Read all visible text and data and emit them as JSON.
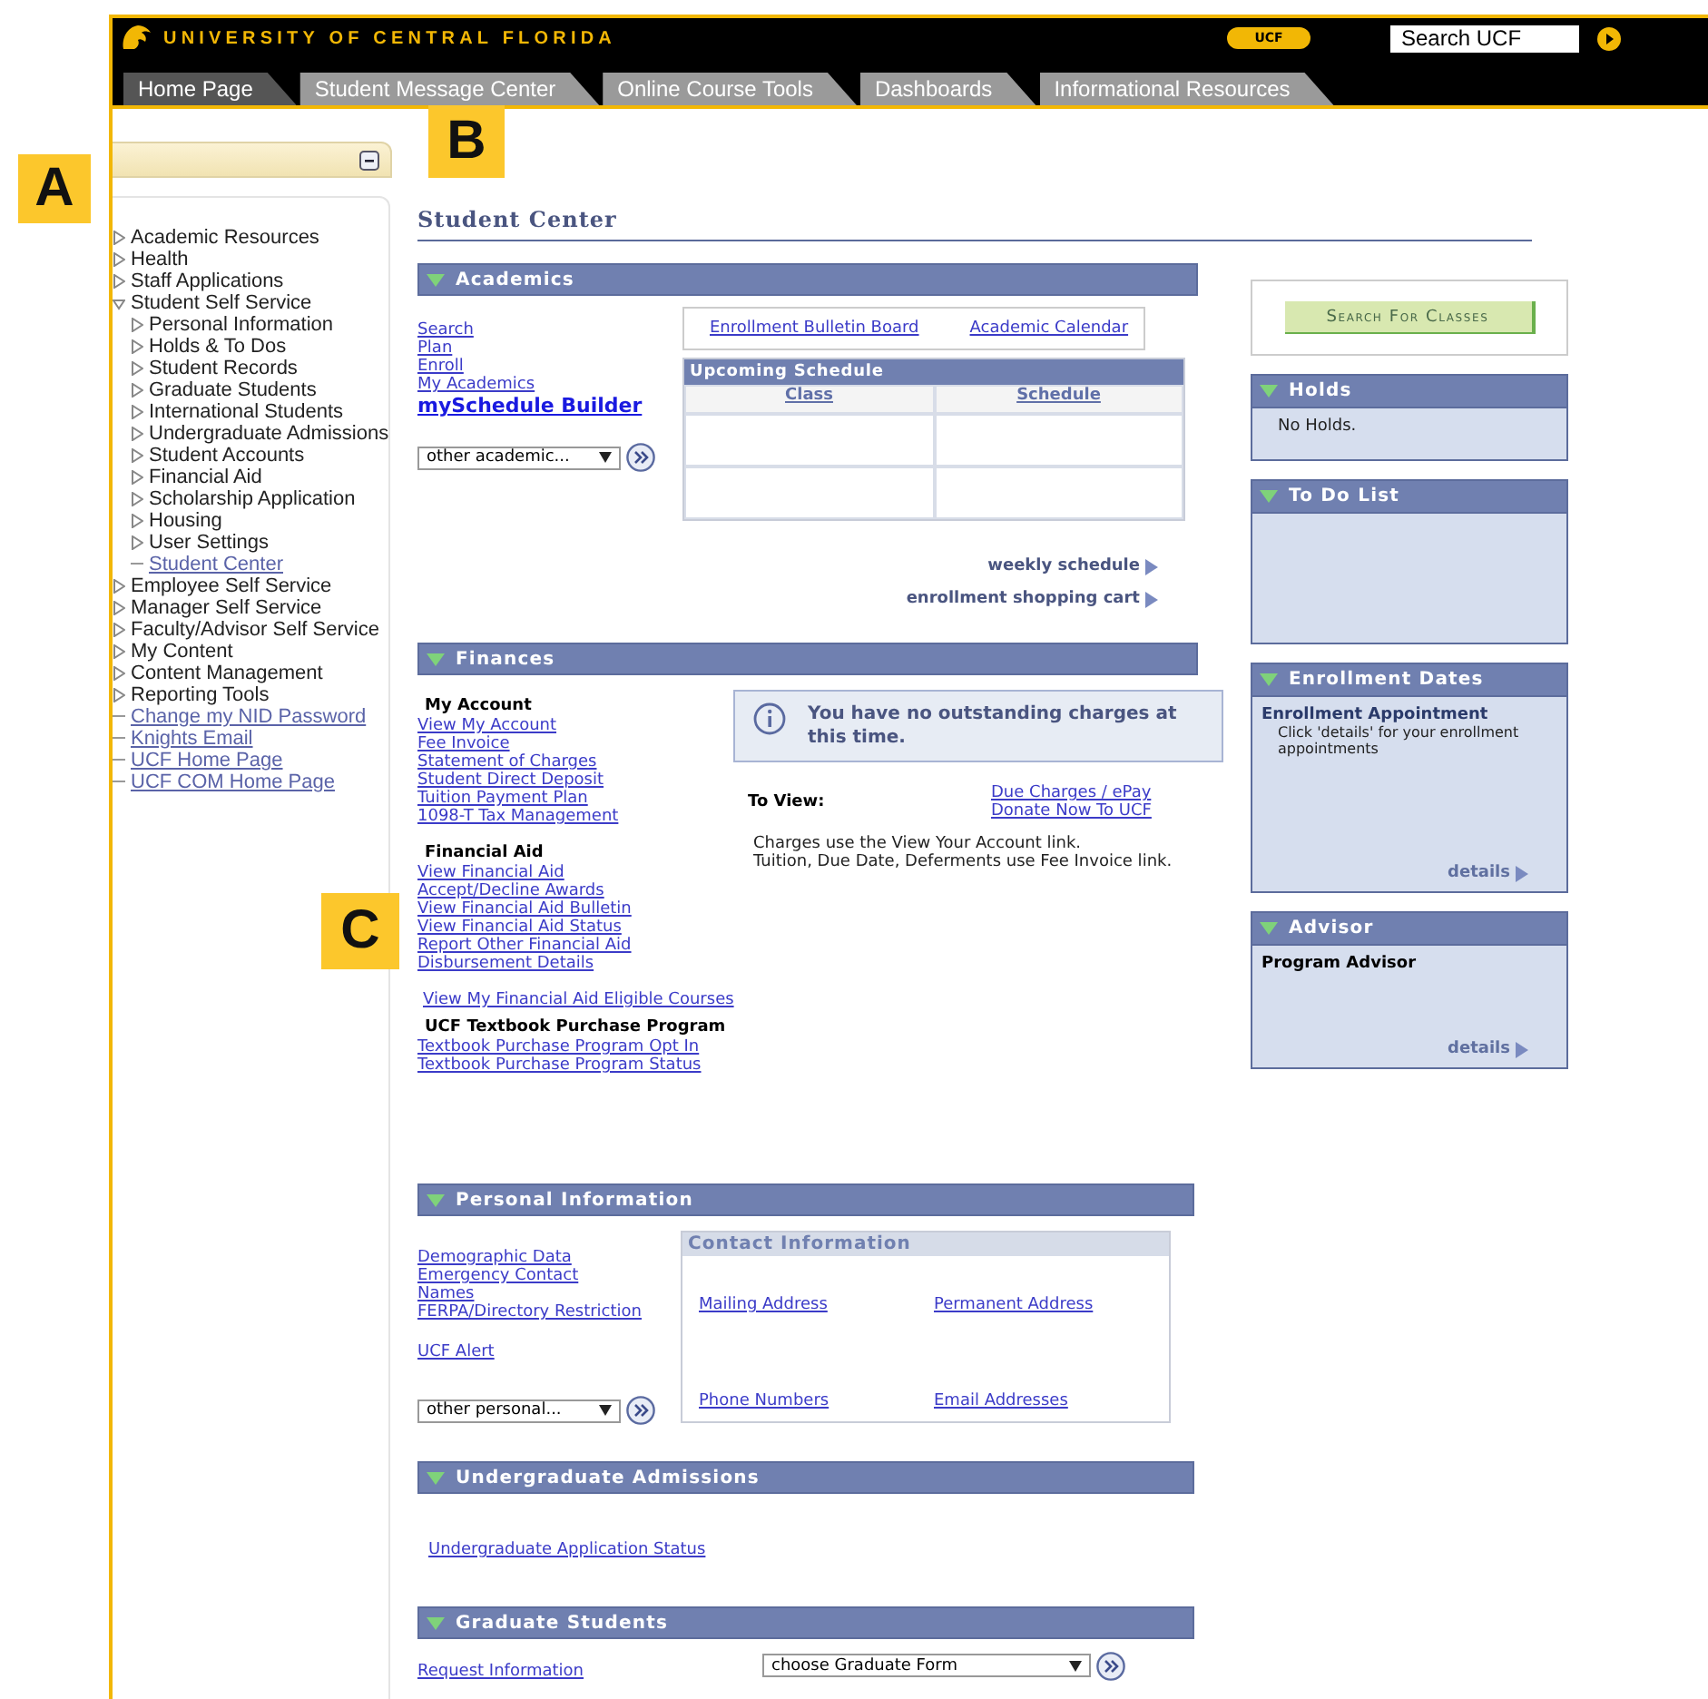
{
  "callouts": [
    "A",
    "B",
    "C"
  ],
  "header": {
    "university": "UNIVERSITY OF CENTRAL FLORIDA",
    "badge": "UCF",
    "search": {
      "placeholder": "Search UCF"
    }
  },
  "tabs": [
    {
      "label": "Home Page",
      "selected": true
    },
    {
      "label": "Student Message Center",
      "selected": false
    },
    {
      "label": "Online Course Tools",
      "selected": false
    },
    {
      "label": "Dashboards",
      "selected": false
    },
    {
      "label": "Informational Resources",
      "selected": false
    }
  ],
  "sidebar": {
    "items": [
      {
        "label": "Academic Resources",
        "kind": "folder",
        "expanded": false
      },
      {
        "label": "Health",
        "kind": "folder",
        "expanded": false
      },
      {
        "label": "Staff Applications",
        "kind": "folder",
        "expanded": false
      },
      {
        "label": "Student Self Service",
        "kind": "folder",
        "expanded": true,
        "children": [
          {
            "label": "Personal Information",
            "kind": "folder",
            "expanded": false
          },
          {
            "label": "Holds & To Dos",
            "kind": "folder",
            "expanded": false
          },
          {
            "label": "Student Records",
            "kind": "folder",
            "expanded": false
          },
          {
            "label": "Graduate Students",
            "kind": "folder",
            "expanded": false
          },
          {
            "label": "International Students",
            "kind": "folder",
            "expanded": false
          },
          {
            "label": "Undergraduate Admissions",
            "kind": "folder",
            "expanded": false
          },
          {
            "label": "Student Accounts",
            "kind": "folder",
            "expanded": false
          },
          {
            "label": "Financial Aid",
            "kind": "folder",
            "expanded": false
          },
          {
            "label": "Scholarship Application",
            "kind": "folder",
            "expanded": false
          },
          {
            "label": "Housing",
            "kind": "folder",
            "expanded": false
          },
          {
            "label": "User Settings",
            "kind": "folder",
            "expanded": false
          },
          {
            "label": "Student Center",
            "kind": "link"
          }
        ]
      },
      {
        "label": "Employee Self Service",
        "kind": "folder",
        "expanded": false
      },
      {
        "label": "Manager Self Service",
        "kind": "folder",
        "expanded": false
      },
      {
        "label": "Faculty/Advisor Self Service",
        "kind": "folder",
        "expanded": false
      },
      {
        "label": "My Content",
        "kind": "folder",
        "expanded": false
      },
      {
        "label": "Content Management",
        "kind": "folder",
        "expanded": false
      },
      {
        "label": "Reporting Tools",
        "kind": "folder",
        "expanded": false
      },
      {
        "label": "Change my NID Password",
        "kind": "link"
      },
      {
        "label": "Knights Email",
        "kind": "link"
      },
      {
        "label": "UCF Home Page",
        "kind": "link"
      },
      {
        "label": "UCF COM Home Page",
        "kind": "link"
      }
    ]
  },
  "main": {
    "title": "Student Center",
    "academics": {
      "title": "Academics",
      "links": [
        "Search",
        "Plan",
        "Enroll",
        "My Academics"
      ],
      "builder": "mySchedule Builder",
      "dropdown": "other academic...",
      "top_links": [
        "Enrollment Bulletin Board",
        "Academic Calendar"
      ],
      "schedule": {
        "title": "Upcoming Schedule",
        "columns": [
          "Class",
          "Schedule"
        ]
      },
      "bottom_links": [
        "weekly schedule",
        "enrollment shopping cart"
      ]
    },
    "finances": {
      "title": "Finances",
      "groups": [
        {
          "heading": "My Account",
          "links": [
            "View My Account",
            "Fee Invoice",
            "Statement of Charges",
            "Student Direct Deposit",
            "Tuition Payment Plan",
            "1098-T Tax Management"
          ]
        },
        {
          "heading": "Financial Aid",
          "links": [
            "View Financial Aid",
            "Accept/Decline Awards",
            "View Financial Aid Bulletin",
            "View Financial Aid Status",
            "Report Other Financial Aid",
            "Disbursement Details"
          ]
        },
        {
          "links": [
            "View My Financial Aid Eligible Courses"
          ]
        },
        {
          "heading": "UCF Textbook Purchase Program",
          "links": [
            "Textbook Purchase Program Opt In",
            "Textbook Purchase Program Status"
          ]
        }
      ],
      "message": "You have no outstanding charges at this time.",
      "to_view": "To View:",
      "to_view_links": [
        "Due Charges / ePay",
        "Donate Now To UCF"
      ],
      "notes": [
        "Charges use the View Your Account link.",
        "Tuition, Due Date, Deferments use Fee Invoice link."
      ]
    },
    "personal": {
      "title": "Personal Information",
      "links": [
        "Demographic Data",
        "Emergency Contact",
        "Names",
        "FERPA/Directory Restriction"
      ],
      "alert": "UCF Alert",
      "dropdown": "other personal...",
      "contact": {
        "title": "Contact Information",
        "links": [
          "Mailing Address",
          "Permanent Address",
          "Phone Numbers",
          "Email Addresses"
        ]
      }
    },
    "undergrad": {
      "title": "Undergraduate Admissions",
      "link": "Undergraduate Application Status"
    },
    "graduate": {
      "title": "Graduate Students",
      "link": "Request Information",
      "dropdown": "choose Graduate Form"
    }
  },
  "right": {
    "search_button": "Search For Classes",
    "holds": {
      "title": "Holds",
      "text": "No Holds."
    },
    "todo": {
      "title": "To Do List"
    },
    "enrollment": {
      "title": "Enrollment Dates",
      "heading": "Enrollment Appointment",
      "text": "Click 'details' for your enrollment appointments",
      "link": "details"
    },
    "advisor": {
      "title": "Advisor",
      "heading": "Program Advisor",
      "link": "details"
    }
  }
}
